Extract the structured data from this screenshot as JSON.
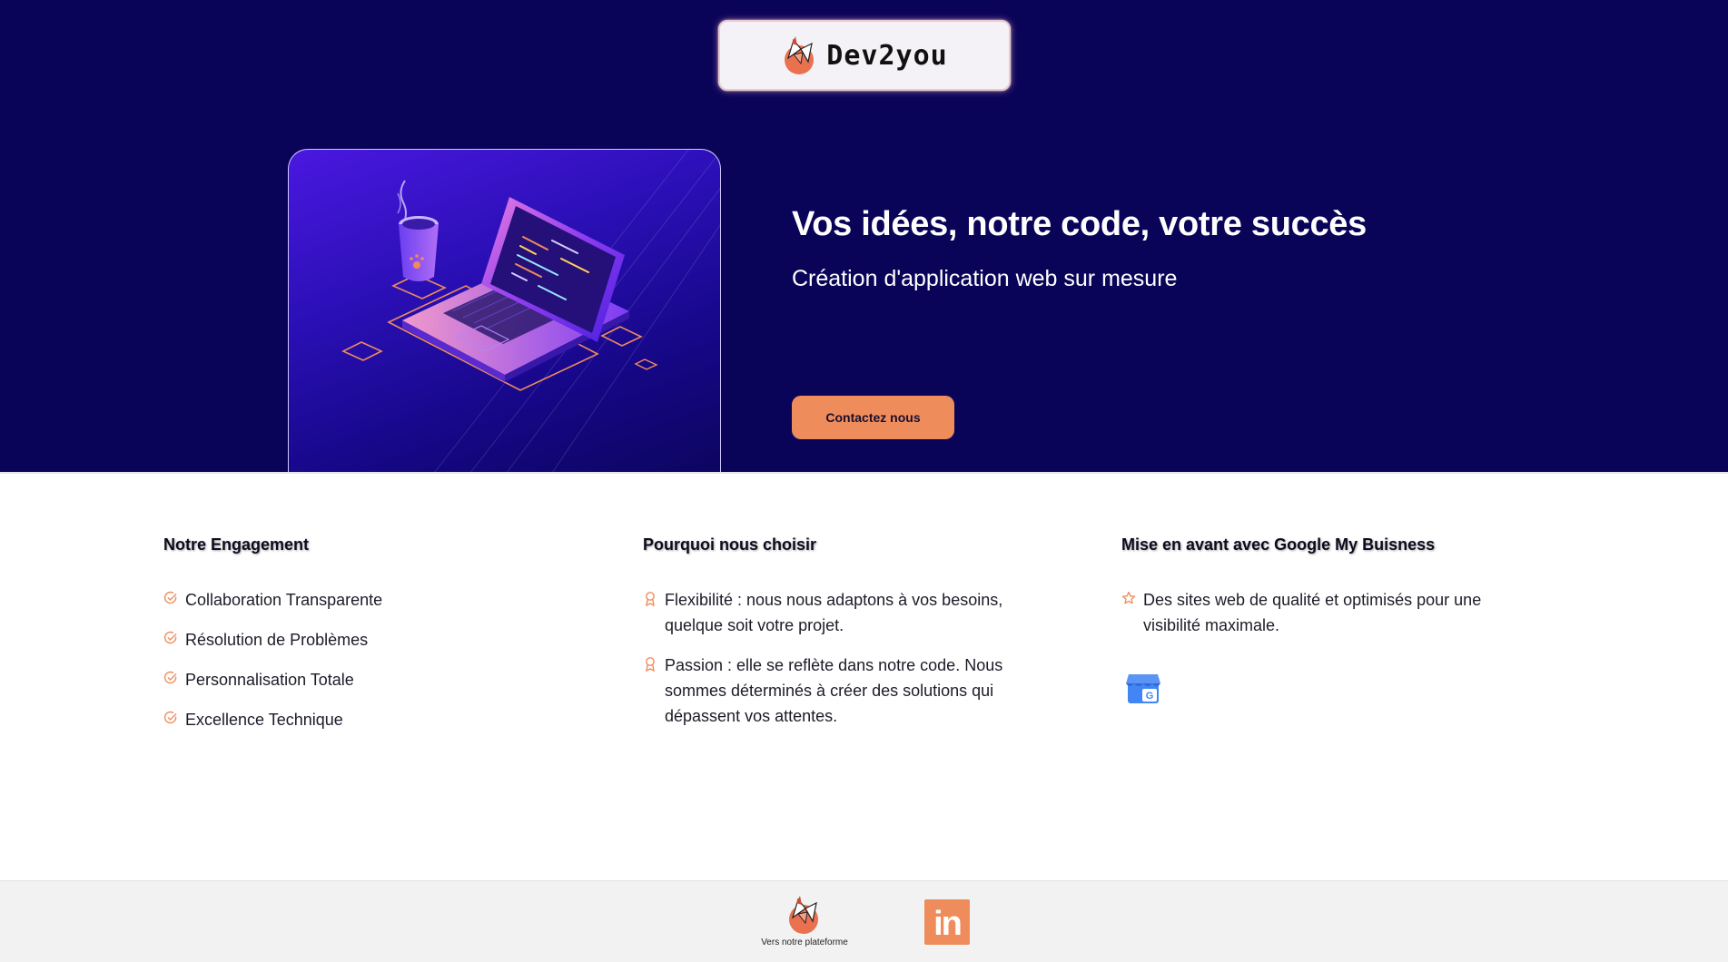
{
  "brand": {
    "name": "Dev2you",
    "logo_icon": "fox-logo-icon",
    "colors": {
      "hero_bg": "#0a0459",
      "accent": "#ef8c5c",
      "white": "#ffffff"
    }
  },
  "hero": {
    "title": "Vos idées, notre code, votre succès",
    "subtitle": "Création d'application web sur mesure",
    "cta_label": "Contactez nous",
    "illustration_icon": "laptop-coffee-illustration"
  },
  "features": {
    "engagement": {
      "heading": "Notre Engagement",
      "icon": "check-circle-icon",
      "items": [
        "Collaboration Transparente",
        "Résolution de Problèmes",
        "Personnalisation Totale",
        "Excellence Technique"
      ]
    },
    "why": {
      "heading": "Pourquoi nous choisir",
      "icon": "award-ribbon-icon",
      "items": [
        "Flexibilité : nous nous adaptons à vos besoins, quelque soit votre projet.",
        "Passion : elle se reflète dans notre code. Nous sommes déterminés à créer des solutions qui dépassent vos attentes."
      ]
    },
    "gmb": {
      "heading": "Mise en avant avec Google My Buisness",
      "icon": "star-outline-icon",
      "items": [
        "Des sites web de qualité et optimisés pour une visibilité maximale."
      ],
      "badge_icon": "google-my-business-icon"
    }
  },
  "footer": {
    "platform_label": "Vers notre plateforme",
    "linkedin_text": "in",
    "linkedin_icon": "linkedin-icon"
  }
}
